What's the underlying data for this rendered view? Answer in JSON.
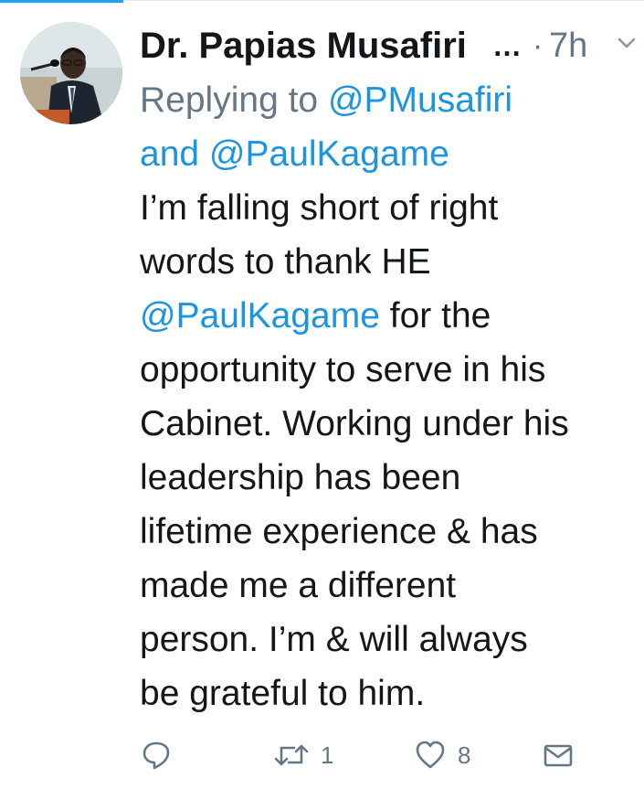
{
  "tweet": {
    "display_name": "Dr. Papias Musafiri",
    "name_ellipsis": "…",
    "dot": "·",
    "timestamp": "7h",
    "reply": {
      "prefix": "Replying to ",
      "mention_1": "@PMusafiri",
      "conjunction": "and ",
      "mention_2": "@PaulKagame"
    },
    "text": {
      "line_1": "I’m falling short of right",
      "line_2": "words to thank HE",
      "line_3_mention": "@PaulKagame",
      "line_3_rest": " for the",
      "line_4": "opportunity to serve in his",
      "line_5": "Cabinet. Working under his",
      "line_6": "leadership has been",
      "line_7": "lifetime experience & has",
      "line_8": "made me a different",
      "line_9": "person. I’m & will always",
      "line_10": "be grateful to him."
    },
    "actions": {
      "reply_icon": "reply-icon",
      "retweet_icon": "retweet-icon",
      "retweet_count": "1",
      "like_icon": "heart-icon",
      "like_count": "8",
      "dm_icon": "envelope-icon"
    }
  },
  "colors": {
    "link": "#1b95e0",
    "muted": "#657786",
    "text": "#14171a",
    "accent": "#1da1f2"
  }
}
